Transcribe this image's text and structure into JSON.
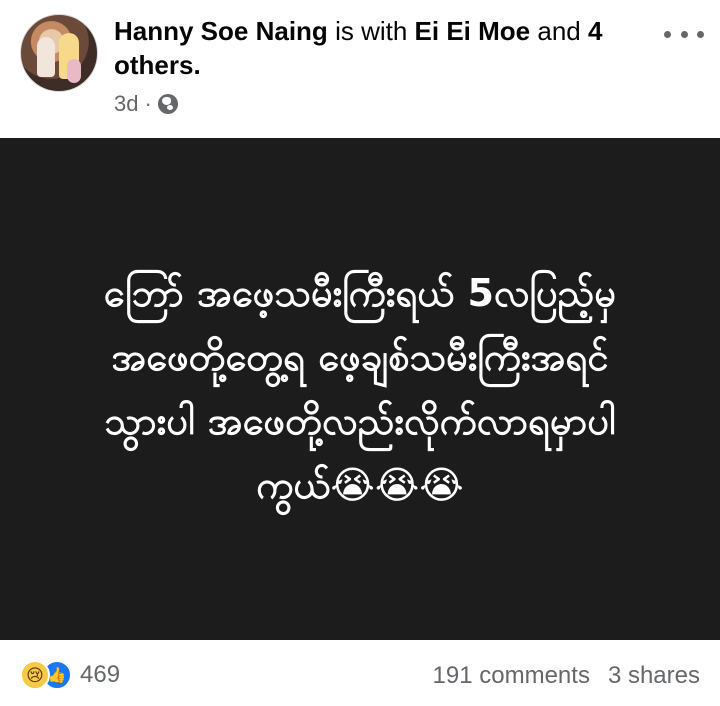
{
  "post": {
    "author": "Hanny Soe Naing",
    "is_with_text": "is with",
    "tagged_name": "Ei Ei Moe",
    "and_text": "and",
    "others_text": "4 others.",
    "timestamp": "3d",
    "separator": "·",
    "audience_icon": "globe-icon",
    "more_icon": "more-options-icon"
  },
  "content": {
    "text": "ဘြော်  အဖေ့သမီးကြီးရယ်  5လပြည့်မှ\nအဖေတို့တွေ့ရ  ဖေ့ချစ်သမီးကြီးအရင်\nသွားပါ  အဖေတို့လည်းလိုက်လာရမှာပါ\nကွယ်😭😭😭"
  },
  "footer": {
    "reaction_icons": [
      "sad-reaction-icon",
      "like-reaction-icon"
    ],
    "reaction_count": "469",
    "comments": "191 comments",
    "shares": "3 shares"
  },
  "colors": {
    "media_background": "#1c1c1c",
    "secondary_text": "#65676b",
    "like_blue": "#1877f2"
  }
}
